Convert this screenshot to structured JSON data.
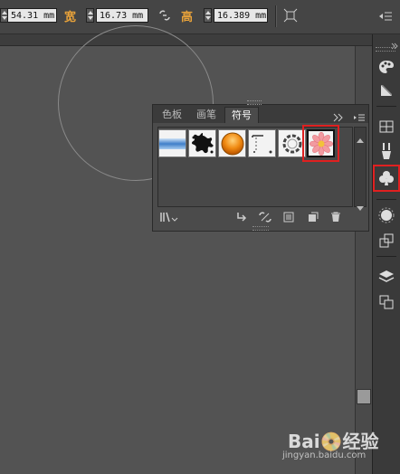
{
  "control_bar": {
    "x_value": "54.31 mm",
    "width_label": "宽",
    "width_value": "16.73 mm",
    "height_label": "高",
    "height_value": "16.389 mm"
  },
  "symbols_panel": {
    "tabs": [
      {
        "label": "色板",
        "active": false
      },
      {
        "label": "画笔",
        "active": false
      },
      {
        "label": "符号",
        "active": true
      }
    ],
    "menu_icon": "panel-menu-icon",
    "symbols": [
      {
        "name": "blue-banner-symbol"
      },
      {
        "name": "ink-splat-symbol"
      },
      {
        "name": "orange-orb-symbol"
      },
      {
        "name": "frame-corner-symbol"
      },
      {
        "name": "ring-knot-symbol"
      },
      {
        "name": "pink-flower-symbol",
        "selected": true
      }
    ],
    "footer_icons": [
      "symbol-libraries-icon",
      "place-symbol-icon",
      "break-link-icon",
      "symbol-options-icon",
      "new-symbol-icon",
      "delete-symbol-icon"
    ]
  },
  "dock": {
    "icons": [
      "color-palette-icon",
      "gradient-icon",
      "grid-swatches-icon",
      "brushes-icon",
      "symbols-icon",
      "appearance-icon",
      "transform-icon",
      "layers-icon",
      "artboards-icon"
    ],
    "highlighted": "symbols-icon"
  },
  "watermark": {
    "brand": "Bai📀经验",
    "url": "jingyan.baidu.com"
  }
}
